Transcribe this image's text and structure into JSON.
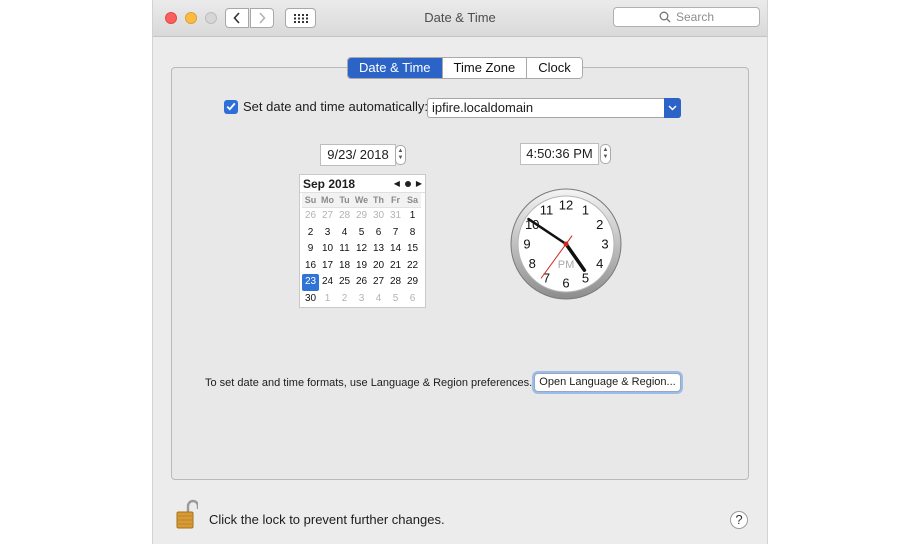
{
  "window": {
    "title": "Date & Time",
    "search_placeholder": "Search"
  },
  "tabs": [
    {
      "label": "Date & Time",
      "active": true
    },
    {
      "label": "Time Zone",
      "active": false
    },
    {
      "label": "Clock",
      "active": false
    }
  ],
  "auto": {
    "label": "Set date and time automatically:",
    "checked": true,
    "server": "ipfire.localdomain"
  },
  "date_field": "9/23/ 2018",
  "time_field": "4:50:36 PM",
  "calendar": {
    "month_label": "Sep 2018",
    "weekdays": [
      "Su",
      "Mo",
      "Tu",
      "We",
      "Th",
      "Fr",
      "Sa"
    ],
    "weeks": [
      [
        "26",
        "27",
        "28",
        "29",
        "30",
        "31",
        "1"
      ],
      [
        "2",
        "3",
        "4",
        "5",
        "6",
        "7",
        "8"
      ],
      [
        "9",
        "10",
        "11",
        "12",
        "13",
        "14",
        "15"
      ],
      [
        "16",
        "17",
        "18",
        "19",
        "20",
        "21",
        "22"
      ],
      [
        "23",
        "24",
        "25",
        "26",
        "27",
        "28",
        "29"
      ],
      [
        "30",
        "1",
        "2",
        "3",
        "4",
        "5",
        "6"
      ]
    ],
    "selected": "23"
  },
  "clock": {
    "numbers": [
      "12",
      "1",
      "2",
      "3",
      "4",
      "5",
      "6",
      "7",
      "8",
      "9",
      "10",
      "11"
    ],
    "ampm": "PM",
    "hour": 4,
    "minute": 50,
    "second": 36
  },
  "formats": {
    "text": "To set date and time formats, use Language & Region preferences.",
    "button": "Open Language & Region..."
  },
  "lock": {
    "text": "Click the lock to prevent further changes."
  },
  "help_label": "?",
  "colors": {
    "accent": "#2b63c7",
    "selected_day": "#2f74d6",
    "second_hand": "#d0271d"
  }
}
